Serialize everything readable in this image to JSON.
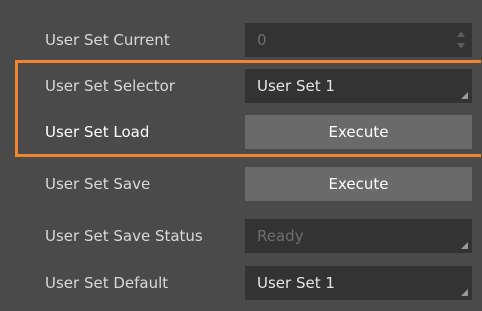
{
  "rows": [
    {
      "label": "User Set Current",
      "value": "0"
    },
    {
      "label": "User Set Selector",
      "value": "User Set 1"
    },
    {
      "label": "User Set Load",
      "button": "Execute"
    },
    {
      "label": "User Set Save",
      "button": "Execute"
    },
    {
      "label": "User Set Save Status",
      "value": "Ready"
    },
    {
      "label": "User Set Default",
      "value": "User Set 1"
    }
  ],
  "colors": {
    "background": "#4a4a4a",
    "field": "#333333",
    "button": "#6a6a6a",
    "highlight": "#f2862e"
  }
}
